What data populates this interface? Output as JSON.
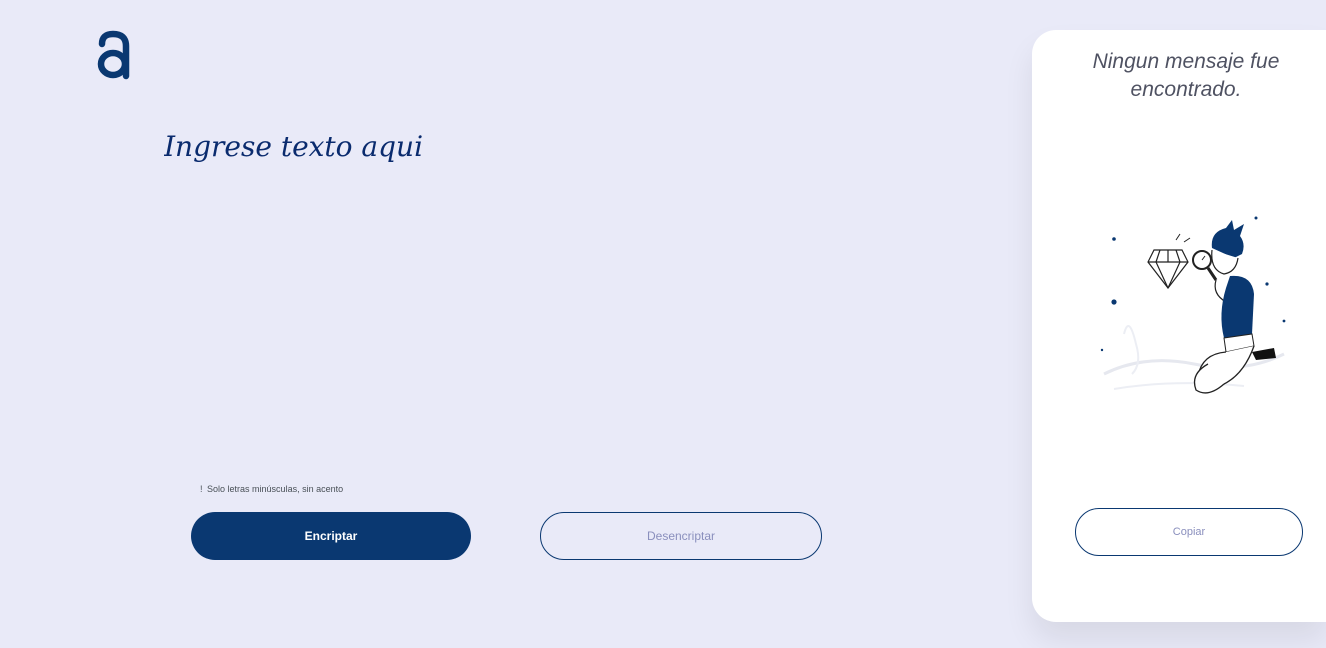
{
  "logo": {
    "text": "a",
    "icon": "alura-logo"
  },
  "input": {
    "placeholder": "Ingrese texto aqui"
  },
  "hint": {
    "icon": "exclamation-icon",
    "text": "Solo letras minúsculas, sin acento"
  },
  "buttons": {
    "encrypt": "Encriptar",
    "decrypt": "Desencriptar"
  },
  "output": {
    "title_line1": "Ningun mensaje fue",
    "title_line2": "encontrado.",
    "illustration": "boy-with-magnifying-glass-illustration",
    "copy_label": "Copiar"
  },
  "colors": {
    "background": "#e9eaf8",
    "primary": "#0a3871",
    "panel": "#ffffff",
    "muted_text": "#8a8fbd"
  }
}
